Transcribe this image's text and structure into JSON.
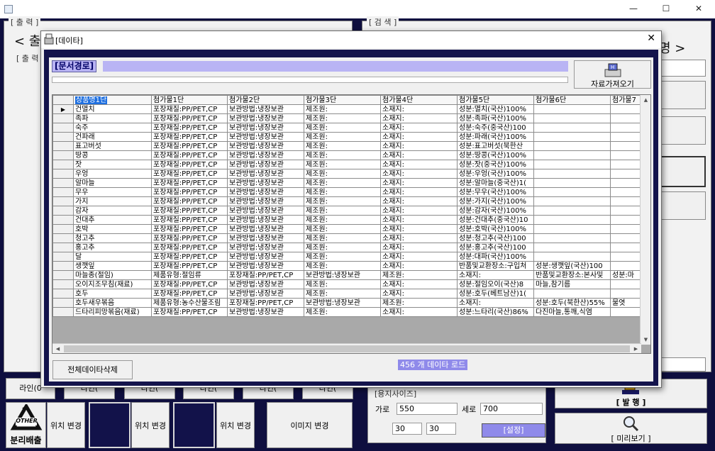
{
  "window": {
    "minimize": "—",
    "maximize": "☐",
    "close": "✕"
  },
  "output": {
    "legend": "[ 출 력 ]",
    "title": "< 출",
    "inner_legend": "[ 출 력"
  },
  "search": {
    "legend": "[ 검 색 ]",
    "title_fragment": "명 >"
  },
  "lines": {
    "first_label": "라인(0",
    "other_label": "라인("
  },
  "bottom_row": {
    "logo_text": "OTHER",
    "logo_caption": "분리배출",
    "move_label": "위치 변경",
    "image_change": "이미지 변경"
  },
  "paper": {
    "legend": "[용지사이즈]",
    "width_label": "가로",
    "width_value": "550",
    "height_label": "세로",
    "height_value": "700",
    "margin_a": "30",
    "margin_b": "30",
    "set_button": "[설정]"
  },
  "actions": {
    "print": "[ 발  행 ]",
    "preview": "[ 미리보기 ]"
  },
  "dialog": {
    "title": "[데이타]",
    "close": "✕",
    "doc_path_label": "[문서경로]",
    "doc_path_value": "",
    "fetch_button": "자료가져오기",
    "delete_all_button": "전체데이타삭제",
    "load_status": "456 개 데이타 로드"
  },
  "grid": {
    "columns": [
      "상품명1단",
      "첨가물1단",
      "첨가물2단",
      "첨가물3단",
      "첨가물4단",
      "첨가물5단",
      "첨가물6단",
      "첨가물7"
    ],
    "rows": [
      [
        "건멸치",
        "포장재질:PP/PET,CP",
        "보관방법:냉장보관",
        "제조원:",
        "소재지:",
        "성분:멸치(국산)100%",
        "",
        ""
      ],
      [
        "족파",
        "포장재질:PP/PET,CP",
        "보관방법:냉장보관",
        "제조원:",
        "소재지:",
        "성분:족파(국산)100%",
        "",
        ""
      ],
      [
        "숙주",
        "포장재질:PP/PET,CP",
        "보관방법:냉장보관",
        "제조원:",
        "소재지:",
        "성분:숙주(중국산)100",
        "",
        ""
      ],
      [
        "건파래",
        "포장재질:PP/PET,CP",
        "보관방법:냉장보관",
        "제조원:",
        "소재지:",
        "성분:파래(국산)100%",
        "",
        ""
      ],
      [
        "표고버섯",
        "포장재질:PP/PET,CP",
        "보관방법:냉장보관",
        "제조원:",
        "소재지:",
        "성분:표고버섯(북한산",
        "",
        ""
      ],
      [
        "땅콩",
        "포장재질:PP/PET,CP",
        "보관방법:냉장보관",
        "제조원:",
        "소재지:",
        "성분:땅콩(국산)100%",
        "",
        ""
      ],
      [
        "잣",
        "포장재질:PP/PET,CP",
        "보관방법:냉장보관",
        "제조원:",
        "소재지:",
        "성분:잣(중국산)100%",
        "",
        ""
      ],
      [
        "우엉",
        "포장재질:PP/PET,CP",
        "보관방법:냉장보관",
        "제조원:",
        "소재지:",
        "성분:우엉(국산)100%",
        "",
        ""
      ],
      [
        "알마늘",
        "포장재질:PP/PET,CP",
        "보관방법:냉장보관",
        "제조원:",
        "소재지:",
        "성분:알마늘(중국산)1(",
        "",
        ""
      ],
      [
        "무우",
        "포장재질:PP/PET,CP",
        "보관방법:냉장보관",
        "제조원:",
        "소재지:",
        "성분:무우(국산)100%",
        "",
        ""
      ],
      [
        "가지",
        "포장재질:PP/PET,CP",
        "보관방법:냉장보관",
        "제조원:",
        "소재지:",
        "성분:가지(국산)100%",
        "",
        ""
      ],
      [
        "감자",
        "포장재질:PP/PET,CP",
        "보관방법:냉장보관",
        "제조원:",
        "소재지:",
        "성분:감자(국산)100%",
        "",
        ""
      ],
      [
        "건대추",
        "포장재질:PP/PET,CP",
        "보관방법:냉장보관",
        "제조원:",
        "소재지:",
        "성분:건대추(중국산)10",
        "",
        ""
      ],
      [
        "호박",
        "포장재질:PP/PET,CP",
        "보관방법:냉장보관",
        "제조원:",
        "소재지:",
        "성분:호박(국산)100%",
        "",
        ""
      ],
      [
        "청고추",
        "포장재질:PP/PET,CP",
        "보관방법:냉장보관",
        "제조원:",
        "소재지:",
        "성분:청고추(국산)100",
        "",
        ""
      ],
      [
        "홍고추",
        "포장재질:PP/PET,CP",
        "보관방법:냉장보관",
        "제조원:",
        "소재지:",
        "성분:홍고추(국산)100",
        "",
        ""
      ],
      [
        "달",
        "포장재질:PP/PET,CP",
        "보관방법:냉장보관",
        "제조원:",
        "소재지:",
        "성분:대파(국산)100%",
        "",
        ""
      ],
      [
        "생깻잎",
        "포장재질:PP/PET,CP",
        "보관방법:냉장보관",
        "제조원:",
        "소재지:",
        "반품및교환장소:구입처",
        "성분:생깻잎(국산)100",
        ""
      ],
      [
        "마늘종(절임)",
        "제품유형:절임류",
        "포장재질:PP/PET,CP",
        "보관방법:냉장보관",
        "제조원:",
        "소재지:",
        "반품및교환장소:본사및",
        "성분:마"
      ],
      [
        "오이지조무침(재료)",
        "포장재질:PP/PET,CP",
        "보관방법:냉장보관",
        "제조원:",
        "소재지:",
        "성분:절임오이(국산)8",
        "마늘,참기름",
        ""
      ],
      [
        "호두",
        "포장재질:PP/PET,CP",
        "보관방법:냉장보관",
        "제조원:",
        "소재지:",
        "성분:호두(베트남산)1(",
        "",
        ""
      ],
      [
        "호두새우볶음",
        "제품유형:농수산물조림",
        "포장재질:PP/PET,CP",
        "보관방법:냉장보관",
        "제조원:",
        "소재지:",
        "성분:호두(북한산)55%",
        "물엿"
      ],
      [
        "드타리피망볶음(재료)",
        "포장재질:PP/PET,CP",
        "보관방법:냉장보관",
        "제조원:",
        "소재지:",
        "성분:느타리(국산)86%",
        "다진마늘,통깨,식염",
        ""
      ]
    ]
  }
}
